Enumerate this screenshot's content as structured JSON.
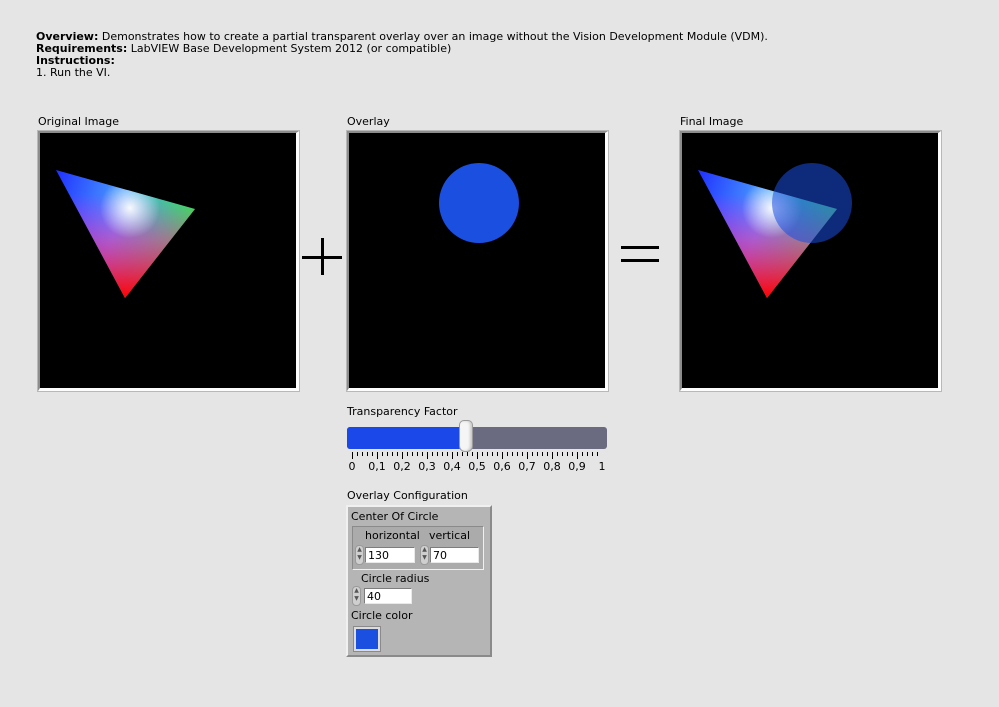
{
  "description": {
    "overview_label": "Overview:",
    "overview_text": " Demonstrates how to create a partial transparent overlay over an image without the Vision Development Module (VDM).",
    "requirements_label": "Requirements:",
    "requirements_text": " LabVIEW Base Development System 2012 (or compatible)",
    "instructions_label": "Instructions:",
    "instructions_step1": "1. Run the VI."
  },
  "images": {
    "original_label": "Original Image",
    "overlay_label": "Overlay",
    "final_label": "Final Image",
    "plus_icon": "plus-operator",
    "equals_icon": "equals-operator"
  },
  "transparency": {
    "label": "Transparency Factor",
    "value": 0.45,
    "min": 0,
    "max": 1,
    "tick_labels": [
      "0",
      "0,1",
      "0,2",
      "0,3",
      "0,4",
      "0,5",
      "0,6",
      "0,7",
      "0,8",
      "0,9",
      "1"
    ],
    "fill_color": "#1b48e8",
    "track_color": "#6a6a80"
  },
  "overlay_config": {
    "label": "Overlay Configuration",
    "center_label": "Center Of Circle",
    "horizontal_label": "horizontal",
    "horizontal_value": "130",
    "vertical_label": "vertical",
    "vertical_value": "70",
    "radius_label": "Circle radius",
    "radius_value": "40",
    "color_label": "Circle color",
    "circle_color": "#1a4fe0"
  }
}
